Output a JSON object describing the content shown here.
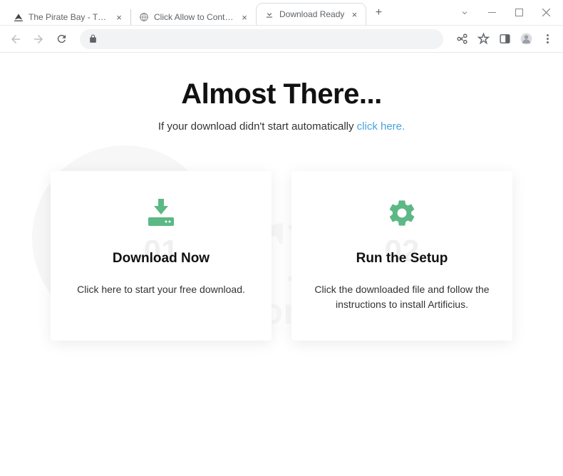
{
  "tabs": [
    {
      "label": "The Pirate Bay - The galaxy's mo",
      "icon": "ship"
    },
    {
      "label": "Click Allow to Continue",
      "icon": "globe"
    },
    {
      "label": "Download Ready",
      "icon": "download",
      "active": true
    }
  ],
  "hero": {
    "title": "Almost There...",
    "subtitle_prefix": "If your download didn't start automatically ",
    "link": "click here."
  },
  "cards": [
    {
      "step": "01",
      "title": "Download Now",
      "desc": "Click here to start your free download.",
      "icon": "download"
    },
    {
      "step": "02",
      "title": "Run the Setup",
      "desc": "Click the downloaded file and follow the instructions to install Artificius.",
      "icon": "gear"
    }
  ]
}
